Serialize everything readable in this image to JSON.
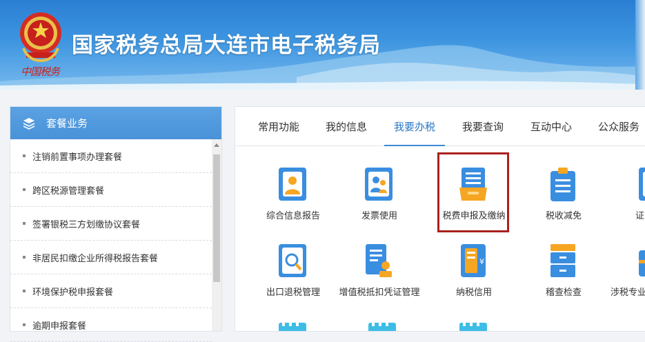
{
  "header": {
    "site_title": "国家税务总局大连市电子税务局",
    "emblem_caption": "中国税务"
  },
  "sidebar": {
    "title": "套餐业务",
    "items": [
      {
        "label": "注销前置事项办理套餐"
      },
      {
        "label": "跨区税源管理套餐"
      },
      {
        "label": "签署银税三方划缴协议套餐"
      },
      {
        "label": "非居民扣缴企业所得税报告套餐"
      },
      {
        "label": "环境保护税申报套餐"
      },
      {
        "label": "逾期申报套餐"
      }
    ]
  },
  "tabs": [
    {
      "label": "常用功能",
      "active": false
    },
    {
      "label": "我的信息",
      "active": false
    },
    {
      "label": "我要办税",
      "active": true
    },
    {
      "label": "我要查询",
      "active": false
    },
    {
      "label": "互动中心",
      "active": false
    },
    {
      "label": "公众服务",
      "active": false
    }
  ],
  "functions": {
    "row1": [
      {
        "label": "综合信息报告",
        "icon": "person-card-icon"
      },
      {
        "label": "发票使用",
        "icon": "people-icon"
      },
      {
        "label": "税费申报及缴纳",
        "icon": "tray-document-icon",
        "highlighted": true
      },
      {
        "label": "税收减免",
        "icon": "clipboard-icon"
      },
      {
        "label": "证明开具",
        "icon": "certificate-icon"
      }
    ],
    "row2": [
      {
        "label": "出口退税管理",
        "icon": "document-search-icon"
      },
      {
        "label": "增值税抵扣凭证管理",
        "icon": "document-stamp-icon"
      },
      {
        "label": "纳税信用",
        "icon": "yuan-document-icon"
      },
      {
        "label": "稽查检查",
        "icon": "cabinet-icon"
      },
      {
        "label": "涉税专业服务机构管理",
        "icon": "toolbox-icon"
      }
    ]
  },
  "colors": {
    "accent": "#3c88d6",
    "highlight_border": "#a9201e",
    "header_blue": "#2b7fd3",
    "icon_blue": "#3a8ee0",
    "icon_orange": "#f5a623"
  }
}
